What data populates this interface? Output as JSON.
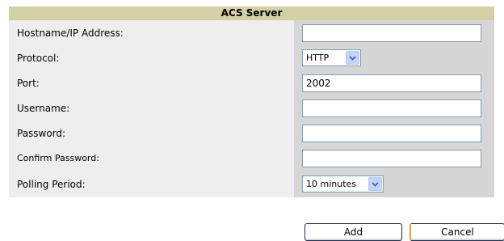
{
  "panel": {
    "title": "ACS Server"
  },
  "fields": {
    "hostname": {
      "label": "Hostname/IP Address:",
      "value": ""
    },
    "protocol": {
      "label": "Protocol:",
      "selected": "HTTP"
    },
    "port": {
      "label": "Port:",
      "value": "2002"
    },
    "username": {
      "label": "Username:",
      "value": ""
    },
    "password": {
      "label": "Password:",
      "value": ""
    },
    "confirm_password": {
      "label": "Confirm Password:",
      "value": ""
    },
    "polling_period": {
      "label": "Polling Period:",
      "selected": "10 minutes"
    }
  },
  "buttons": {
    "add_label": "Add",
    "cancel_label": "Cancel"
  },
  "colors": {
    "header_bg": "#d4d0a6",
    "label_bg": "#eeeeee",
    "value_bg": "#d6d6d6",
    "input_border": "#7f9db9",
    "dropdown_button": "#c3d4fc"
  },
  "icons": {
    "dropdown": "chevron-down-icon"
  }
}
